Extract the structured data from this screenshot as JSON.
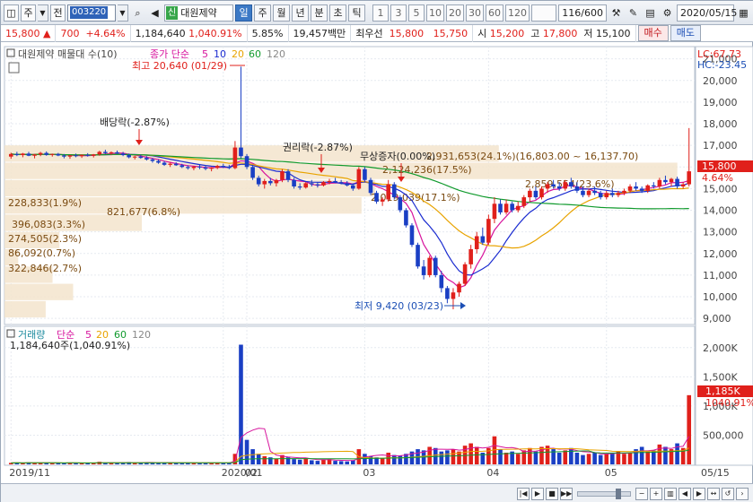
{
  "toolbar": {
    "mode_label": "주",
    "market_label": "전",
    "stock_code": "003220",
    "stock_name": "대원제약",
    "credit_badge": "신",
    "periods": [
      "일",
      "주",
      "월",
      "년",
      "분",
      "초",
      "틱"
    ],
    "active_period": "일",
    "intervals": [
      "1",
      "3",
      "5",
      "10",
      "20",
      "30",
      "60",
      "120"
    ],
    "count": "116/600",
    "date": "2020/05/15"
  },
  "quote": {
    "price": "15,800",
    "change": "700",
    "change_pct": "+4.64%",
    "volume": "1,184,640",
    "volume_ratio": "1,040.91%",
    "turnover_pct": "5.85%",
    "amount": "19,457백만",
    "bid_label": "최우선",
    "bid_sell": "15,800",
    "bid_buy": "15,750",
    "open_label": "시",
    "open": "15,200",
    "high_label": "고",
    "high": "17,800",
    "low_label": "저",
    "low": "15,100",
    "buy_label": "매수",
    "sell_label": "매도"
  },
  "price_panel": {
    "title": "대원제약 매물대 수(10)",
    "ma_label": "종가 단순",
    "ma_periods": [
      "5",
      "10",
      "20",
      "60",
      "120"
    ],
    "ma_colors": [
      "#d7149d",
      "#1a2bd0",
      "#e8a300",
      "#109a2d",
      "#888888"
    ],
    "lc_label": "LC:67.73",
    "hc_label": "HC:-23.45",
    "high_annot": "최고 20,640 (01/29)",
    "low_annot": "최저 9,420 (03/23)",
    "event_dividend": "배당락(-2.87%)",
    "event_rights": "권리락(-2.87%)",
    "event_bonus": "무상증자(0.00%)",
    "current_price_tag": "15,800",
    "current_pct_tag": "4.64%",
    "profile_labels": [
      "228,833(1.9%)",
      "396,083(3.3%)",
      "274,505(2.3%)",
      "86,092(0.7%)",
      "322,846(2.7%)",
      "821,677(6.8%)",
      "2,019,039(17.1%)",
      "2,124,236(17.5%)",
      "2,931,653(24.1%)(16,803.00 ~ 16,137.70)",
      "2,859,554(23.6%)"
    ],
    "y_ticks": [
      "21,000",
      "20,000",
      "19,000",
      "18,000",
      "17,000",
      "16,000",
      "15,000",
      "14,000",
      "13,000",
      "12,000",
      "11,000",
      "10,000",
      "9,000"
    ]
  },
  "volume_panel": {
    "title": "거래량",
    "ma_label": "단순",
    "ma_periods": [
      "5",
      "20",
      "60",
      "120"
    ],
    "ma_colors": [
      "#d7149d",
      "#e8a300",
      "#109a2d",
      "#888888"
    ],
    "current_label": "1,184,640주(1,040.91%)",
    "current_tag": "1,185K",
    "current_pct_tag": "1040.91%",
    "y_ticks": [
      "2,000K",
      "1,500K",
      "1,000K",
      "500,000"
    ]
  },
  "x_axis": {
    "labels": [
      "2019/11",
      "2020/01",
      "02",
      "03",
      "04",
      "05"
    ],
    "last_label": "05/15"
  },
  "chart_data": {
    "type": "candlestick",
    "ylim": [
      8800,
      21400
    ],
    "candles": [
      [
        16480,
        16660,
        16380,
        16600
      ],
      [
        16600,
        16700,
        16500,
        16550
      ],
      [
        16550,
        16650,
        16450,
        16620
      ],
      [
        16620,
        16700,
        16500,
        16520
      ],
      [
        16520,
        16600,
        16400,
        16580
      ],
      [
        16580,
        16700,
        16500,
        16650
      ],
      [
        16650,
        16720,
        16520,
        16560
      ],
      [
        16560,
        16620,
        16480,
        16600
      ],
      [
        16600,
        16650,
        16500,
        16530
      ],
      [
        16530,
        16600,
        16400,
        16480
      ],
      [
        16480,
        16560,
        16380,
        16540
      ],
      [
        16540,
        16620,
        16450,
        16500
      ],
      [
        16500,
        16580,
        16420,
        16560
      ],
      [
        16560,
        16640,
        16480,
        16520
      ],
      [
        16520,
        16600,
        16440,
        16580
      ],
      [
        16580,
        16750,
        16520,
        16700
      ],
      [
        16700,
        16800,
        16600,
        16640
      ],
      [
        16640,
        16720,
        16560,
        16680
      ],
      [
        16680,
        16760,
        16600,
        16620
      ],
      [
        16620,
        16700,
        16500,
        16550
      ],
      [
        16550,
        16620,
        16400,
        16450
      ],
      [
        16450,
        16520,
        16350,
        16480
      ],
      [
        16480,
        16560,
        16380,
        16420
      ],
      [
        16420,
        16500,
        16300,
        16350
      ],
      [
        16350,
        16420,
        16200,
        16280
      ],
      [
        16280,
        16350,
        16150,
        16200
      ],
      [
        16200,
        16280,
        16050,
        16100
      ],
      [
        16100,
        16200,
        16000,
        16150
      ],
      [
        16150,
        16220,
        16050,
        16080
      ],
      [
        16080,
        16150,
        15950,
        16000
      ],
      [
        16000,
        16080,
        15880,
        15950
      ],
      [
        15950,
        16050,
        15850,
        16020
      ],
      [
        16020,
        16120,
        15900,
        15980
      ],
      [
        15980,
        16050,
        15850,
        15920
      ],
      [
        15920,
        16000,
        15800,
        15960
      ],
      [
        15960,
        16100,
        15900,
        16050
      ],
      [
        16050,
        16150,
        15950,
        16000
      ],
      [
        16000,
        16100,
        15900,
        15950
      ],
      [
        15950,
        17200,
        15900,
        16900
      ],
      [
        16900,
        20640,
        16400,
        16500
      ],
      [
        16500,
        16600,
        15900,
        16000
      ],
      [
        16000,
        16100,
        15400,
        15500
      ],
      [
        15500,
        15600,
        15100,
        15200
      ],
      [
        15200,
        15450,
        15000,
        15350
      ],
      [
        15350,
        15500,
        15150,
        15250
      ],
      [
        15250,
        15450,
        15100,
        15400
      ],
      [
        15400,
        15900,
        15300,
        15800
      ],
      [
        15800,
        15900,
        15300,
        15400
      ],
      [
        15400,
        15500,
        15000,
        15100
      ],
      [
        15100,
        15250,
        14950,
        15050
      ],
      [
        15050,
        15300,
        15000,
        15250
      ],
      [
        15250,
        15400,
        15100,
        15200
      ],
      [
        15200,
        15300,
        15050,
        15150
      ],
      [
        15150,
        15350,
        15100,
        15300
      ],
      [
        15300,
        15450,
        15200,
        15350
      ],
      [
        15350,
        15500,
        15250,
        15300
      ],
      [
        15300,
        15400,
        15200,
        15250
      ],
      [
        15250,
        15350,
        15100,
        15150
      ],
      [
        15150,
        15250,
        14900,
        15000
      ],
      [
        15000,
        16000,
        14950,
        15900
      ],
      [
        15900,
        16000,
        15300,
        15400
      ],
      [
        15400,
        15500,
        14700,
        14800
      ],
      [
        14800,
        14900,
        14300,
        14400
      ],
      [
        14400,
        14600,
        14200,
        14500
      ],
      [
        14500,
        15400,
        14400,
        15200
      ],
      [
        15200,
        15300,
        14500,
        14600
      ],
      [
        14600,
        14700,
        13900,
        14000
      ],
      [
        14000,
        14100,
        13200,
        13300
      ],
      [
        13300,
        13400,
        12300,
        12400
      ],
      [
        12400,
        12500,
        11300,
        11400
      ],
      [
        11400,
        11700,
        10800,
        11000
      ],
      [
        11000,
        11900,
        10900,
        11800
      ],
      [
        11800,
        11900,
        10900,
        11000
      ],
      [
        11000,
        11200,
        10200,
        10400
      ],
      [
        10400,
        10500,
        9700,
        9900
      ],
      [
        9900,
        10400,
        9420,
        10200
      ],
      [
        10200,
        10700,
        10000,
        10600
      ],
      [
        10600,
        11600,
        10500,
        11500
      ],
      [
        11500,
        12400,
        11300,
        12200
      ],
      [
        12200,
        13000,
        12000,
        12800
      ],
      [
        12800,
        13200,
        12400,
        12500
      ],
      [
        12500,
        13800,
        12400,
        13600
      ],
      [
        13600,
        14600,
        13400,
        14300
      ],
      [
        14300,
        14500,
        13800,
        13900
      ],
      [
        13900,
        14500,
        13800,
        14300
      ],
      [
        14300,
        14400,
        13900,
        14000
      ],
      [
        14000,
        14400,
        13900,
        14200
      ],
      [
        14200,
        14700,
        14100,
        14600
      ],
      [
        14600,
        15000,
        14400,
        14900
      ],
      [
        14900,
        15100,
        14500,
        14600
      ],
      [
        14600,
        15100,
        14500,
        15000
      ],
      [
        15000,
        15300,
        14800,
        15200
      ],
      [
        15200,
        15400,
        15000,
        15100
      ],
      [
        15100,
        15300,
        14900,
        15000
      ],
      [
        15000,
        15400,
        14900,
        15300
      ],
      [
        15300,
        15500,
        15000,
        15100
      ],
      [
        15100,
        15300,
        14800,
        14900
      ],
      [
        14900,
        15100,
        14600,
        14700
      ],
      [
        14700,
        15000,
        14600,
        14900
      ],
      [
        14900,
        15100,
        14700,
        14800
      ],
      [
        14800,
        14900,
        14500,
        14600
      ],
      [
        14600,
        14900,
        14500,
        14800
      ],
      [
        14800,
        15000,
        14600,
        14700
      ],
      [
        14700,
        14900,
        14600,
        14800
      ],
      [
        14800,
        15000,
        14700,
        14900
      ],
      [
        14900,
        15200,
        14800,
        15100
      ],
      [
        15100,
        15300,
        14900,
        15000
      ],
      [
        15000,
        15100,
        14800,
        14900
      ],
      [
        14900,
        15200,
        14800,
        15150
      ],
      [
        15150,
        15300,
        15000,
        15100
      ],
      [
        15100,
        15500,
        15000,
        15400
      ],
      [
        15400,
        15600,
        15200,
        15300
      ],
      [
        15300,
        15500,
        15100,
        15450
      ],
      [
        15450,
        15550,
        15000,
        15100
      ],
      [
        15100,
        15300,
        15000,
        15200
      ],
      [
        15200,
        17800,
        15100,
        15800
      ]
    ],
    "volume": [
      25,
      30,
      20,
      35,
      28,
      22,
      30,
      18,
      25,
      20,
      30,
      22,
      18,
      25,
      20,
      45,
      30,
      25,
      22,
      30,
      40,
      28,
      25,
      35,
      30,
      28,
      32,
      25,
      22,
      30,
      28,
      24,
      20,
      26,
      22,
      30,
      25,
      20,
      180,
      2050,
      420,
      260,
      180,
      140,
      120,
      100,
      160,
      120,
      90,
      80,
      110,
      70,
      60,
      80,
      90,
      60,
      55,
      50,
      70,
      260,
      180,
      140,
      120,
      110,
      200,
      160,
      150,
      180,
      220,
      260,
      240,
      300,
      280,
      220,
      240,
      260,
      220,
      320,
      360,
      300,
      200,
      280,
      480,
      260,
      200,
      220,
      180,
      240,
      280,
      220,
      300,
      320,
      260,
      200,
      240,
      280,
      200,
      160,
      180,
      200,
      160,
      180,
      200,
      220,
      180,
      200,
      260,
      300,
      220,
      240,
      340,
      300,
      260,
      360,
      280,
      1185
    ],
    "volume_ylim": [
      0,
      2150
    ]
  }
}
